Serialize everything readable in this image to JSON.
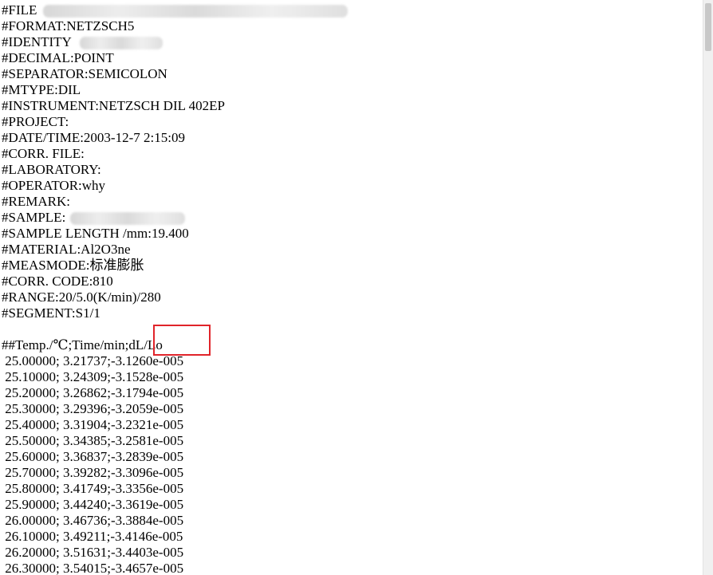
{
  "header_lines": [
    "#FILE",
    "#FORMAT:NETZSCH5",
    "#IDENTITY",
    "#DECIMAL:POINT",
    "#SEPARATOR:SEMICOLON",
    "#MTYPE:DIL",
    "#INSTRUMENT:NETZSCH DIL 402EP",
    "#PROJECT:",
    "#DATE/TIME:2003-12-7 2:15:09",
    "#CORR. FILE:",
    "#LABORATORY:",
    "#OPERATOR:why",
    "#REMARK:",
    "#SAMPLE:",
    "#SAMPLE LENGTH /mm:19.400",
    "#MATERIAL:Al2O3ne",
    "#MEASMODE:标准膨胀",
    "#CORR. CODE:810",
    "#RANGE:20/5.0(K/min)/280",
    "#SEGMENT:S1/1"
  ],
  "column_header": "##Temp./℃;Time/min;dL/Lo",
  "highlighted_column": "dL/Lo",
  "data_rows": [
    " 25.00000; 3.21737;-3.1260e-005",
    " 25.10000; 3.24309;-3.1528e-005",
    " 25.20000; 3.26862;-3.1794e-005",
    " 25.30000; 3.29396;-3.2059e-005",
    " 25.40000; 3.31904;-3.2321e-005",
    " 25.50000; 3.34385;-3.2581e-005",
    " 25.60000; 3.36837;-3.2839e-005",
    " 25.70000; 3.39282;-3.3096e-005",
    " 25.80000; 3.41749;-3.3356e-005",
    " 25.90000; 3.44240;-3.3619e-005",
    " 26.00000; 3.46736;-3.3884e-005",
    " 26.10000; 3.49211;-3.4146e-005",
    " 26.20000; 3.51631;-3.4403e-005",
    " 26.30000; 3.54015;-3.4657e-005"
  ],
  "highlight_color": "#e0242a"
}
